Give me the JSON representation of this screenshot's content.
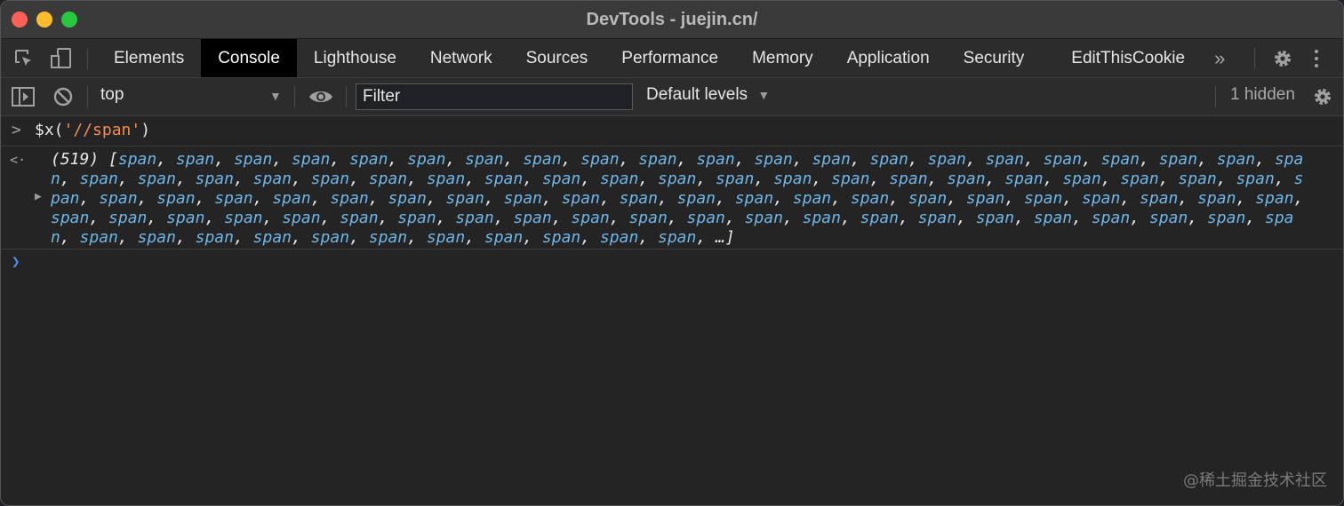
{
  "window": {
    "title": "DevTools - juejin.cn/",
    "traffic_lights": {
      "close": "#fe5f57",
      "minimize": "#febc2e",
      "zoom": "#28c840"
    }
  },
  "tabs": [
    {
      "label": "Elements",
      "active": false
    },
    {
      "label": "Console",
      "active": true
    },
    {
      "label": "Lighthouse",
      "active": false
    },
    {
      "label": "Network",
      "active": false
    },
    {
      "label": "Sources",
      "active": false
    },
    {
      "label": "Performance",
      "active": false
    },
    {
      "label": "Memory",
      "active": false
    },
    {
      "label": "Application",
      "active": false
    },
    {
      "label": "Security",
      "active": false
    },
    {
      "label": "EditThisCookie",
      "active": false
    }
  ],
  "tab_overflow": "»",
  "toolbar": {
    "context": "top",
    "filter_placeholder": "Filter",
    "levels": "Default levels",
    "hidden_count": "1 hidden"
  },
  "console": {
    "command_prefix": "$x(",
    "command_string": "'//span'",
    "command_suffix": ")",
    "result_count": "(519)",
    "result_item": "span",
    "result_item_count": 97,
    "result_ellipsis": "…"
  },
  "watermark": "@稀土掘金技术社区",
  "colors": {
    "accent": "#4d8df0",
    "node_blue": "#6fb6e6",
    "string_orange": "#f28b54"
  }
}
